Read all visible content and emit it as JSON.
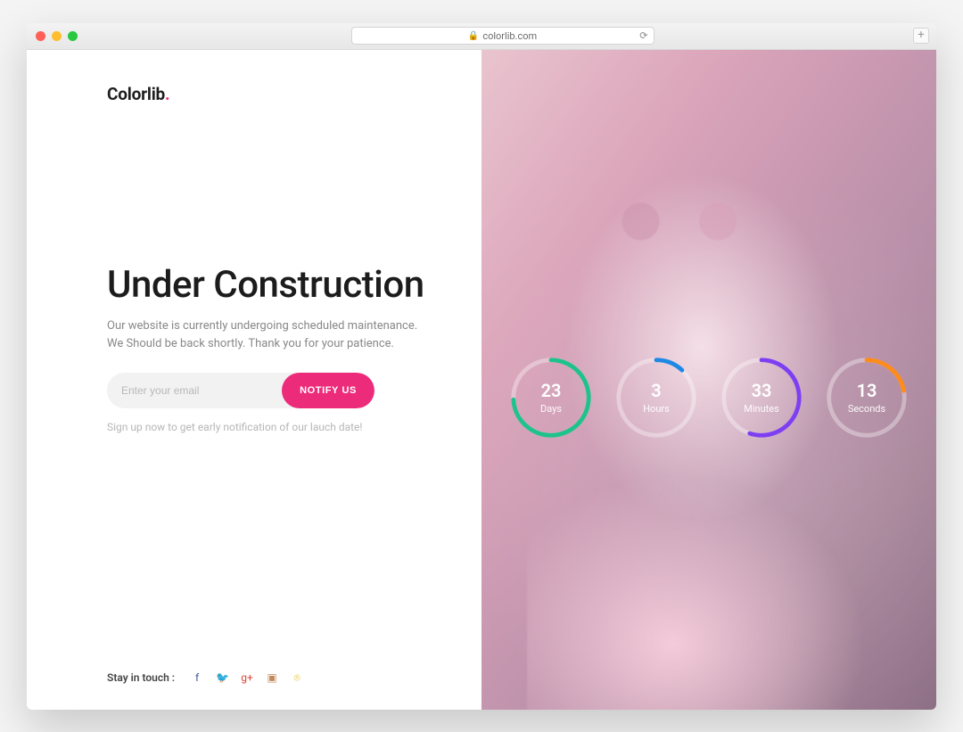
{
  "browser": {
    "url_display": "colorlib.com"
  },
  "brand": {
    "name": "Colorlib",
    "accent_dot": "."
  },
  "hero": {
    "title": "Under Construction",
    "subtitle": "Our website is currently undergoing scheduled maintenance. We Should be back shortly. Thank you for your patience."
  },
  "form": {
    "email_placeholder": "Enter your email",
    "button_label": "NOTIFY US",
    "hint": "Sign up now to get early notification of our lauch date!"
  },
  "social": {
    "label": "Stay in touch :",
    "items": [
      {
        "name": "facebook",
        "glyph": "f"
      },
      {
        "name": "twitter",
        "glyph": "🐦"
      },
      {
        "name": "googleplus",
        "glyph": "g+"
      },
      {
        "name": "instagram",
        "glyph": "▣"
      },
      {
        "name": "pinterest",
        "glyph": "⌾"
      }
    ]
  },
  "countdown": [
    {
      "value": "23",
      "unit": "Days",
      "color": "#1ec28b",
      "progress": 0.74
    },
    {
      "value": "3",
      "unit": "Hours",
      "color": "#1e88e5",
      "progress": 0.12
    },
    {
      "value": "33",
      "unit": "Minutes",
      "color": "#7e3ff2",
      "progress": 0.55
    },
    {
      "value": "13",
      "unit": "Seconds",
      "color": "#ff8c1a",
      "progress": 0.22
    }
  ],
  "colors": {
    "accent": "#ec2b7a"
  }
}
